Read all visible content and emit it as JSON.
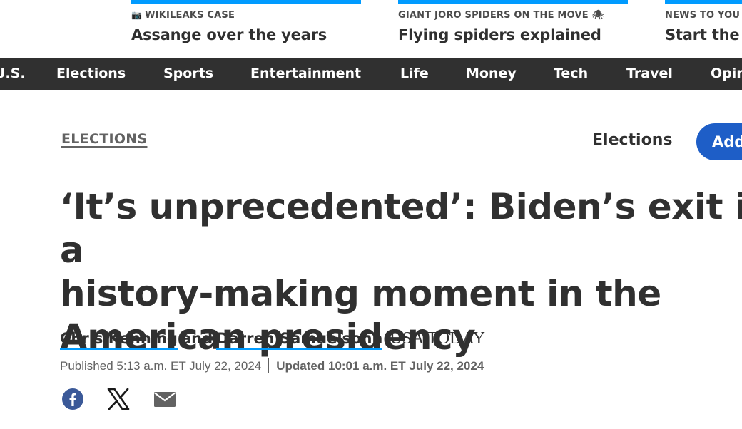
{
  "trending": [
    {
      "kicker": "WIKILEAKS CASE",
      "kicker_icon": "camera-icon",
      "headline": "Assange over the years"
    },
    {
      "kicker": "GIANT JORO SPIDERS ON THE MOVE",
      "kicker_icon": "spider-icon",
      "headline": "Flying spiders explained"
    },
    {
      "kicker": "NEWS TO YOU",
      "headline": "Start the"
    }
  ],
  "nav": {
    "items": [
      "U.S.",
      "Elections",
      "Sports",
      "Entertainment",
      "Life",
      "Money",
      "Tech",
      "Travel",
      "Opinion"
    ]
  },
  "section": {
    "label": "ELECTIONS",
    "topic": "Elections",
    "add_button": "Add"
  },
  "article": {
    "title": "‘It’s unprecedented’: Biden’s exit is a\nhistory-making moment in the\nAmerican presidency",
    "authors": [
      "Chris Kenning",
      "Darren Samuelsohn"
    ],
    "and_text": "and",
    "publication": "USA TODAY",
    "published": "Published 5:13 a.m. ET July 22, 2024",
    "updated": "Updated 10:01 a.m. ET July 22, 2024"
  },
  "share": {
    "icons": [
      "facebook-icon",
      "x-icon",
      "email-icon"
    ]
  },
  "colors": {
    "accent": "#009bff",
    "nav_bg": "#303030",
    "button_blue": "#1e5ec7",
    "facebook": "#3b5998"
  }
}
